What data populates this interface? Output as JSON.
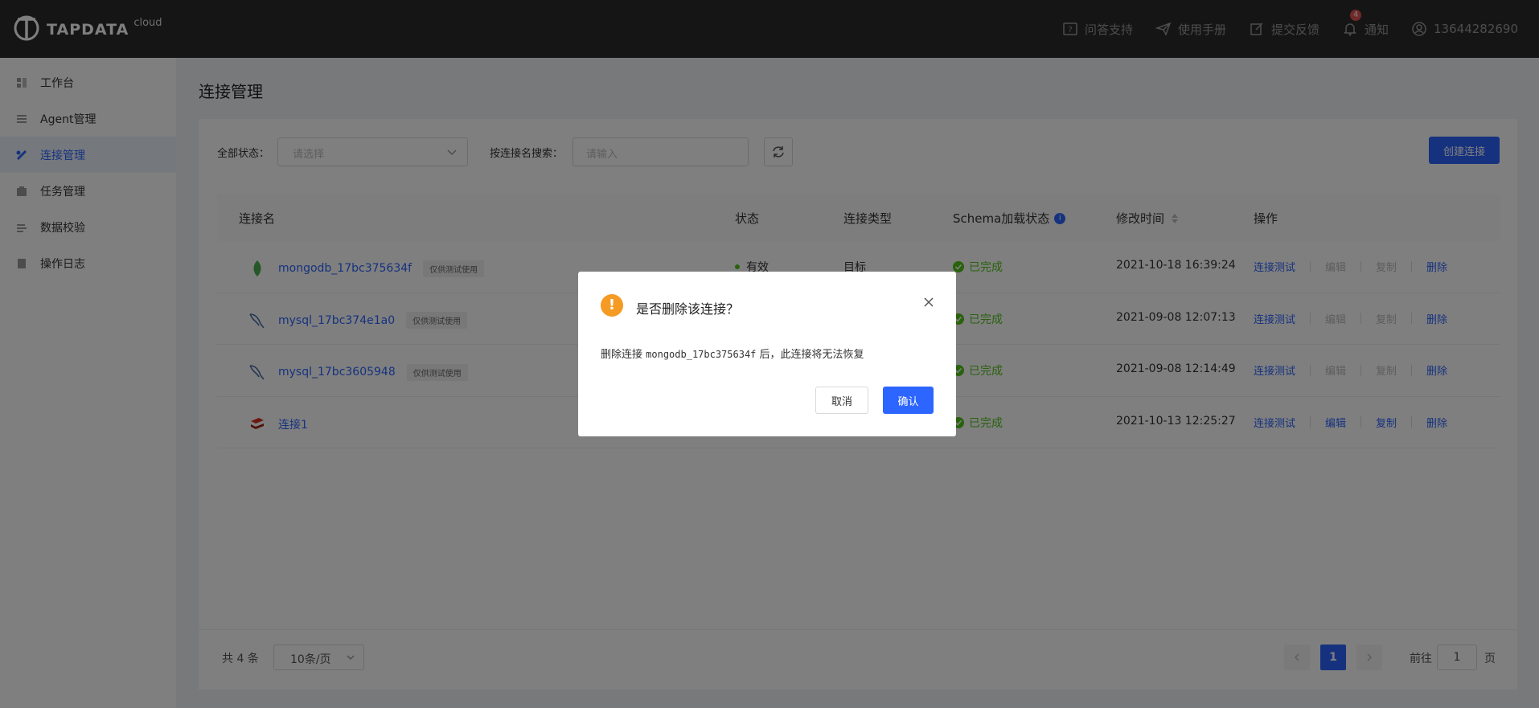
{
  "header": {
    "logo_text": "TAPDATA",
    "logo_suffix": "cloud",
    "items": [
      {
        "label": "问答支持",
        "icon": "question-icon"
      },
      {
        "label": "使用手册",
        "icon": "paper-plane-icon"
      },
      {
        "label": "提交反馈",
        "icon": "edit-icon"
      },
      {
        "label": "通知",
        "icon": "bell-icon",
        "badge": "4"
      }
    ],
    "user": "13644282690"
  },
  "sidebar": {
    "items": [
      {
        "label": "工作台",
        "icon": "dashboard-icon"
      },
      {
        "label": "Agent管理",
        "icon": "list-icon"
      },
      {
        "label": "连接管理",
        "icon": "link-icon",
        "active": true
      },
      {
        "label": "任务管理",
        "icon": "task-icon"
      },
      {
        "label": "数据校验",
        "icon": "check-data-icon"
      },
      {
        "label": "操作日志",
        "icon": "log-icon"
      }
    ]
  },
  "page": {
    "title": "连接管理"
  },
  "filters": {
    "status_label": "全部状态：",
    "status_placeholder": "请选择",
    "search_label": "按连接名搜索：",
    "search_placeholder": "请输入",
    "create_button": "创建连接"
  },
  "table": {
    "headers": {
      "name": "连接名",
      "status": "状态",
      "type": "连接类型",
      "schema": "Schema加载状态",
      "modified": "修改时间",
      "ops": "操作"
    },
    "rows": [
      {
        "name": "mongodb_17bc375634f",
        "tag": "仅供测试使用",
        "db_icon": "mongodb-icon",
        "status": "有效",
        "type": "目标",
        "schema": "已完成",
        "modified": "2021-10-18 16:39:24",
        "ops": [
          "连接测试",
          "编辑",
          "复制",
          "删除"
        ],
        "edit_enabled": false
      },
      {
        "name": "mysql_17bc374e1a0",
        "tag": "仅供测试使用",
        "db_icon": "mysql-icon",
        "schema": "已完成",
        "modified": "2021-09-08 12:07:13",
        "ops": [
          "连接测试",
          "编辑",
          "复制",
          "删除"
        ],
        "edit_enabled": false
      },
      {
        "name": "mysql_17bc3605948",
        "tag": "仅供测试使用",
        "db_icon": "mysql-icon",
        "schema": "已完成",
        "modified": "2021-09-08 12:14:49",
        "ops": [
          "连接测试",
          "编辑",
          "复制",
          "删除"
        ],
        "edit_enabled": false
      },
      {
        "name": "连接1",
        "tag": "",
        "db_icon": "redis-icon",
        "schema": "已完成",
        "modified": "2021-10-13 12:25:27",
        "ops": [
          "连接测试",
          "编辑",
          "复制",
          "删除"
        ],
        "edit_enabled": true
      }
    ]
  },
  "pagination": {
    "total": "共 4 条",
    "page_size": "10条/页",
    "current_page": "1",
    "goto_prefix": "前往",
    "goto_value": "1",
    "goto_suffix": "页"
  },
  "dialog": {
    "title": "是否删除该连接？",
    "message_prefix": "删除连接 ",
    "message_name": "mongodb_17bc375634f",
    "message_suffix": " 后，此连接将无法恢复",
    "cancel": "取消",
    "confirm": "确认"
  },
  "colors": {
    "accent": "#2c65ff",
    "success": "#52c41a",
    "warning": "#f59a23",
    "header_bg": "#2b2b2b"
  }
}
